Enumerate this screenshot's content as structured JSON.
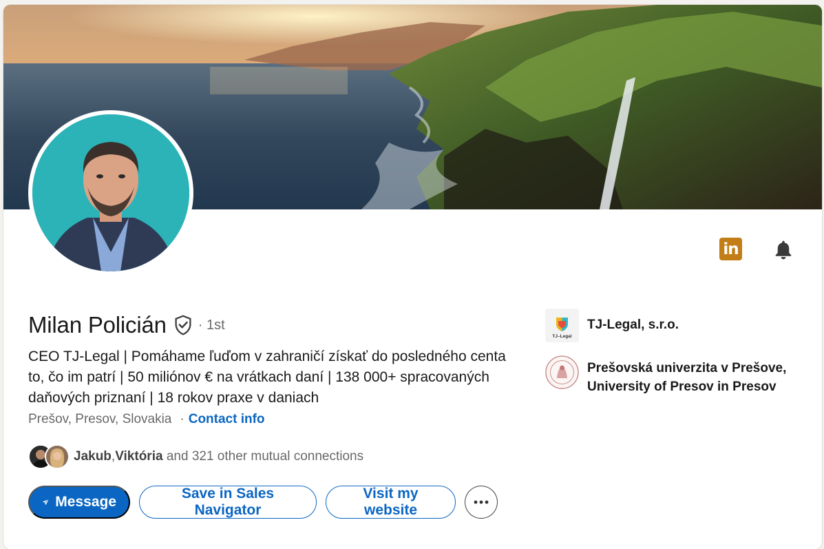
{
  "profile": {
    "name": "Milan Policián",
    "degree": "· 1st",
    "headline": "CEO TJ-Legal | Pomáhame ľuďom v zahraničí získať do posledného centa to, čo im patrí | 50 miliónov € na vrátkach daní | 138 000+ spracovaných daňových priznaní |  18 rokov praxe v daniach",
    "location": "Prešov, Presov, Slovakia",
    "location_separator": "·",
    "contact_info": "Contact info"
  },
  "mutual": {
    "name1": "Jakub",
    "separator": ", ",
    "name2": "Viktória",
    "rest": " and 321 other mutual connections"
  },
  "actions": {
    "message": "Message",
    "save_sales_navigator": "Save in Sales Navigator",
    "visit_website": "Visit my website"
  },
  "organizations": {
    "company": "TJ-Legal, s.r.o.",
    "company_logo_text": "TJ–Legal",
    "school": "Prešovská univerzita v Prešove, University of Presov in Presov"
  },
  "icons": {
    "linkedin": "linkedin-icon",
    "bell": "bell-icon",
    "verified": "verified-shield-icon",
    "send": "send-icon",
    "more": "more-icon"
  },
  "colors": {
    "primary": "#0a66c2",
    "linkedin_badge": "#c37d16",
    "avatar_bg": "#2bb3b8"
  }
}
